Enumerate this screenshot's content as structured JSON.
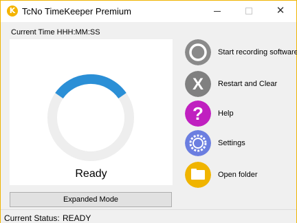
{
  "window": {
    "title": "TcNo TimeKeeper Premium",
    "app_icon_glyph": "K",
    "accent_color": "#f0b400"
  },
  "titlebar_buttons": {
    "minimize_icon": "minimize-icon",
    "maximize_icon": "maximize-icon",
    "close_icon": "close-icon",
    "close_glyph": "✕"
  },
  "timer": {
    "current_time_label": "Current Time HHH:MM:SS",
    "state_text": "Ready",
    "ring_track_color": "#eeeeee",
    "ring_progress_color": "#2b8fd6"
  },
  "expanded_mode_label": "Expanded Mode",
  "actions": [
    {
      "label": "Start recording software",
      "icon": "record-circle-icon",
      "color": "#8a8a8a"
    },
    {
      "label": "Restart and Clear",
      "icon": "x-restart-icon",
      "color": "#808080",
      "glyph": "X"
    },
    {
      "label": "Help",
      "icon": "question-icon",
      "color": "#c020c0",
      "glyph": "?"
    },
    {
      "label": "Settings",
      "icon": "gear-settings-icon",
      "color": "#6b7ee0"
    },
    {
      "label": "Open folder",
      "icon": "folder-icon",
      "color": "#f0b400"
    }
  ],
  "status": {
    "label": "Current Status:",
    "value": "READY"
  }
}
